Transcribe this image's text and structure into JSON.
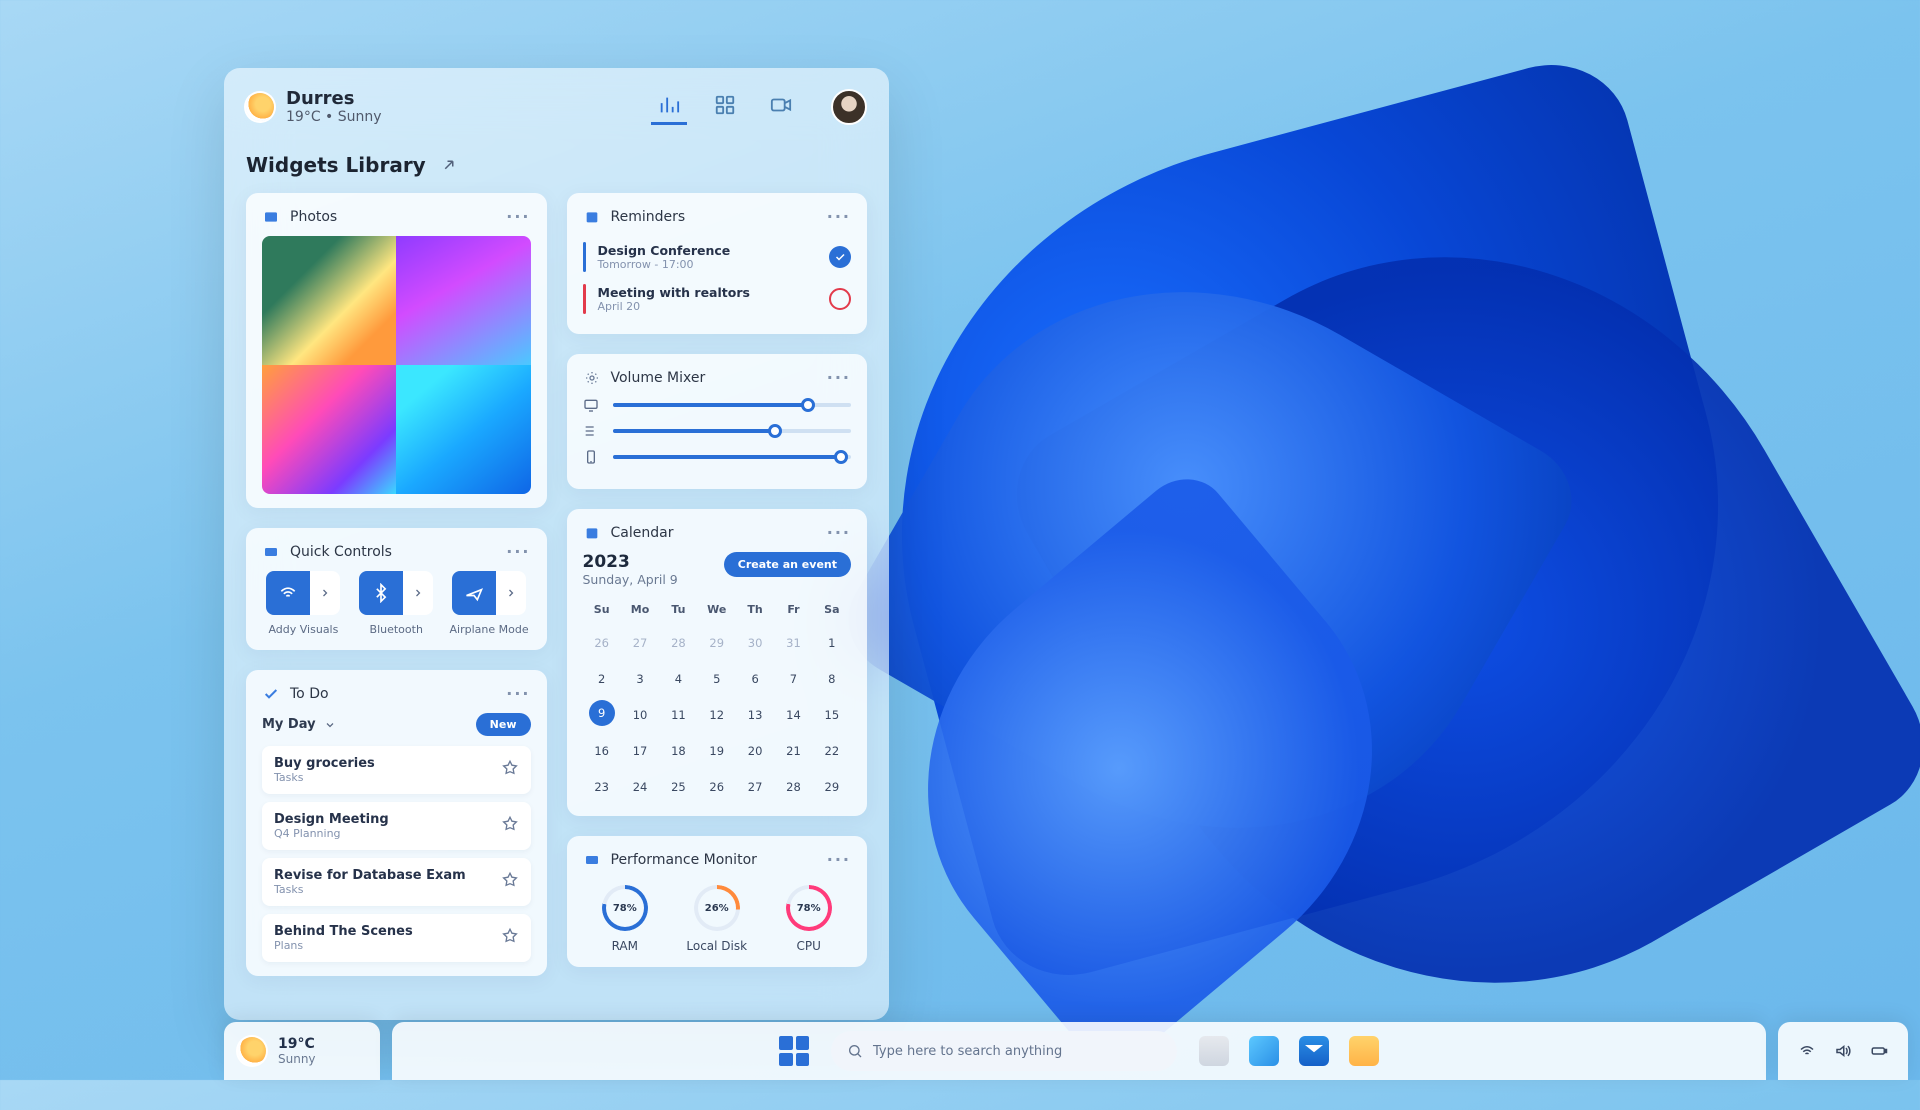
{
  "header": {
    "city": "Durres",
    "temp": "19°C",
    "dot": "•",
    "condition": "Sunny"
  },
  "section_title": "Widgets Library",
  "photos": {
    "title": "Photos"
  },
  "quick_controls": {
    "title": "Quick Controls",
    "items": [
      {
        "label": "Addy Visuals"
      },
      {
        "label": "Bluetooth"
      },
      {
        "label": "Airplane Mode"
      }
    ]
  },
  "todo": {
    "title": "To Do",
    "group": "My Day",
    "new_label": "New",
    "items": [
      {
        "title": "Buy groceries",
        "tag": "Tasks"
      },
      {
        "title": "Design Meeting",
        "tag": "Q4 Planning"
      },
      {
        "title": "Revise for Database Exam",
        "tag": "Tasks"
      },
      {
        "title": "Behind The Scenes",
        "tag": "Plans"
      }
    ]
  },
  "reminders": {
    "title": "Reminders",
    "items": [
      {
        "title": "Design Conference",
        "detail": "Tomorrow - 17:00",
        "done": true
      },
      {
        "title": "Meeting with realtors",
        "detail": "April 20",
        "done": false
      }
    ]
  },
  "volume": {
    "title": "Volume Mixer",
    "levels": [
      82,
      68,
      96
    ]
  },
  "calendar": {
    "title": "Calendar",
    "year": "2023",
    "date": "Sunday, April 9",
    "create": "Create an event",
    "dow": [
      "Su",
      "Mo",
      "Tu",
      "We",
      "Th",
      "Fr",
      "Sa"
    ],
    "days": [
      {
        "n": "26",
        "dim": true
      },
      {
        "n": "27",
        "dim": true
      },
      {
        "n": "28",
        "dim": true
      },
      {
        "n": "29",
        "dim": true
      },
      {
        "n": "30",
        "dim": true
      },
      {
        "n": "31",
        "dim": true
      },
      {
        "n": "1"
      },
      {
        "n": "2"
      },
      {
        "n": "3"
      },
      {
        "n": "4"
      },
      {
        "n": "5"
      },
      {
        "n": "6"
      },
      {
        "n": "7"
      },
      {
        "n": "8"
      },
      {
        "n": "9",
        "today": true
      },
      {
        "n": "10"
      },
      {
        "n": "11"
      },
      {
        "n": "12"
      },
      {
        "n": "13"
      },
      {
        "n": "14"
      },
      {
        "n": "15"
      },
      {
        "n": "16"
      },
      {
        "n": "17"
      },
      {
        "n": "18"
      },
      {
        "n": "19"
      },
      {
        "n": "20"
      },
      {
        "n": "21"
      },
      {
        "n": "22"
      },
      {
        "n": "23"
      },
      {
        "n": "24"
      },
      {
        "n": "25"
      },
      {
        "n": "26"
      },
      {
        "n": "27"
      },
      {
        "n": "28"
      },
      {
        "n": "29"
      }
    ]
  },
  "perf": {
    "title": "Performance Monitor",
    "items": [
      {
        "label": "RAM",
        "pct": "78%",
        "deg": 281,
        "color": "blue"
      },
      {
        "label": "Local Disk",
        "pct": "26%",
        "deg": 94,
        "color": "orange"
      },
      {
        "label": "CPU",
        "pct": "78%",
        "deg": 281,
        "color": "pink"
      }
    ]
  },
  "taskbar": {
    "temp": "19°C",
    "condition": "Sunny",
    "search_placeholder": "Type here to search anything"
  }
}
